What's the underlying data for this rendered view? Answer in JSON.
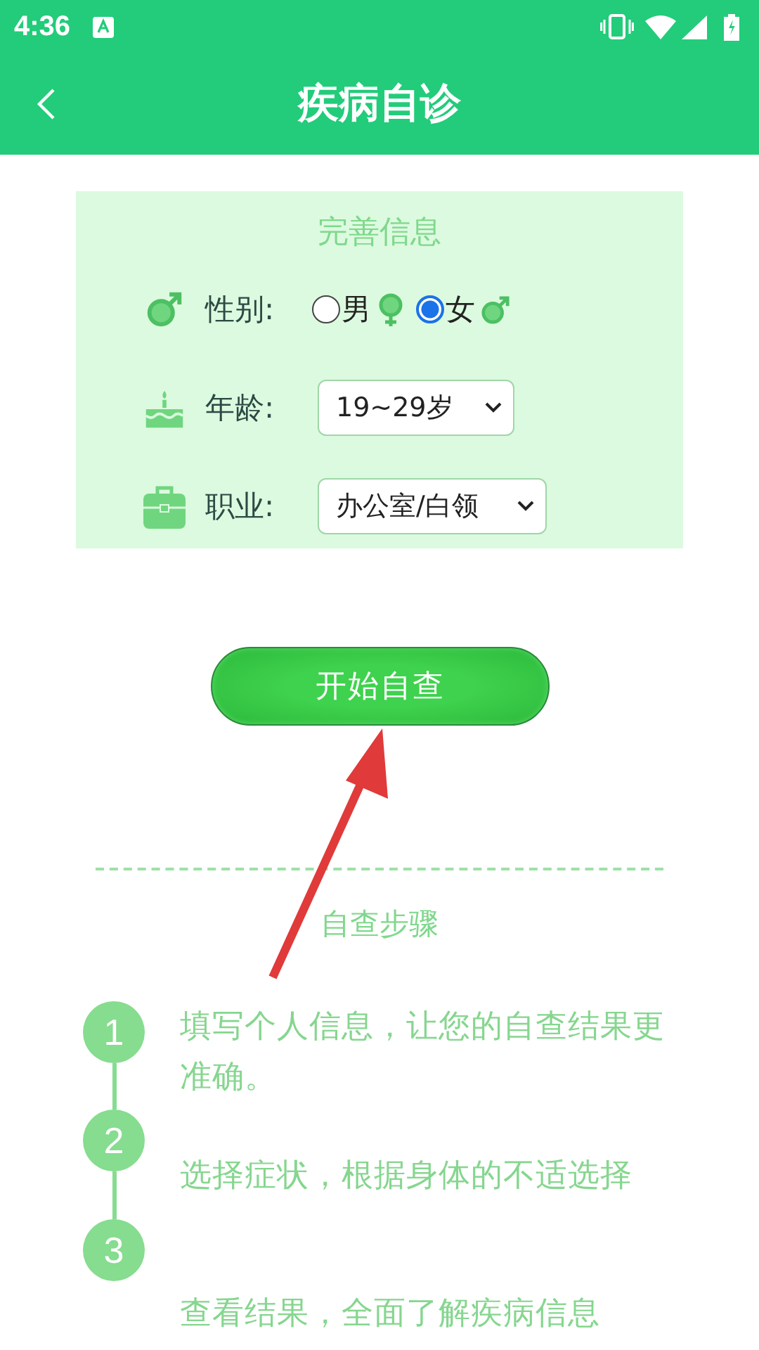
{
  "status_bar": {
    "time": "4:36"
  },
  "app_bar": {
    "title": "疾病自诊"
  },
  "info_card": {
    "title": "完善信息",
    "gender": {
      "label": "性别:",
      "options": [
        {
          "label": "男",
          "selected": false
        },
        {
          "label": "女",
          "selected": true
        }
      ]
    },
    "age": {
      "label": "年龄:",
      "value": "19~29岁"
    },
    "job": {
      "label": "职业:",
      "value": "办公室/白领"
    }
  },
  "start_button": {
    "label": "开始自查"
  },
  "steps": {
    "title": "自查步骤",
    "items": [
      {
        "number": "1",
        "text": "填写个人信息，让您的自查结果更准确。"
      },
      {
        "number": "2",
        "text": "选择症状，根据身体的不适选择"
      },
      {
        "number": "3",
        "text": "查看结果，全面了解疾病信息"
      }
    ]
  }
}
